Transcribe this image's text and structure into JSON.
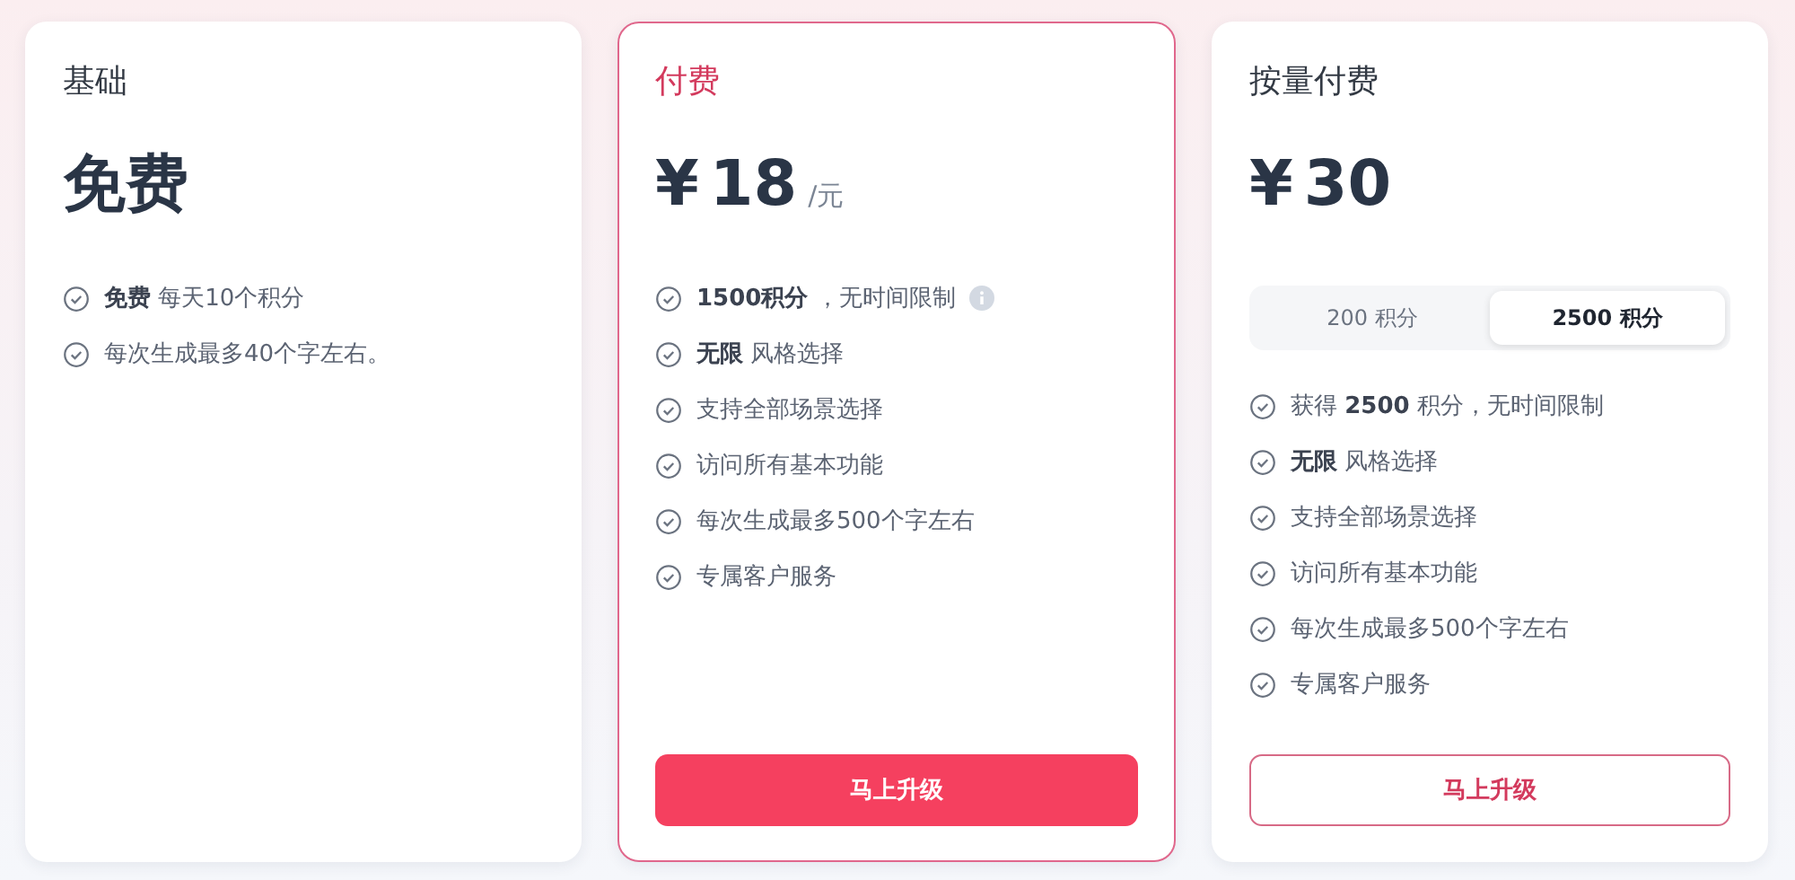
{
  "plans": [
    {
      "title": "基础",
      "featured": false,
      "price": {
        "amount": "免费"
      },
      "features": [
        {
          "text": "**免费** 每天10个积分",
          "info": false
        },
        {
          "text": "每次生成最多40个字左右。",
          "info": false
        }
      ]
    },
    {
      "title": "付费",
      "featured": true,
      "price": {
        "currency": "¥",
        "amount": "18",
        "unit": "/元"
      },
      "features": [
        {
          "text": "**1500积分** ，无时间限制",
          "info": true
        },
        {
          "text": "**无限** 风格选择",
          "info": false
        },
        {
          "text": "支持全部场景选择",
          "info": false
        },
        {
          "text": "访问所有基本功能",
          "info": false
        },
        {
          "text": "每次生成最多500个字左右",
          "info": false
        },
        {
          "text": "专属客户服务",
          "info": false
        }
      ],
      "button": {
        "label": "马上升级",
        "kind": "solid"
      }
    },
    {
      "title": "按量付费",
      "featured": false,
      "price": {
        "currency": "¥",
        "amount": "30"
      },
      "options": [
        {
          "label": "200 积分",
          "selected": false
        },
        {
          "label": "2500 积分",
          "selected": true
        }
      ],
      "features": [
        {
          "text": "获得 **2500** 积分，无时间限制",
          "info": false
        },
        {
          "text": "**无限** 风格选择",
          "info": false
        },
        {
          "text": "支持全部场景选择",
          "info": false
        },
        {
          "text": "访问所有基本功能",
          "info": false
        },
        {
          "text": "每次生成最多500个字左右",
          "info": false
        },
        {
          "text": "专属客户服务",
          "info": false
        }
      ],
      "button": {
        "label": "马上升级",
        "kind": "outline"
      }
    }
  ]
}
